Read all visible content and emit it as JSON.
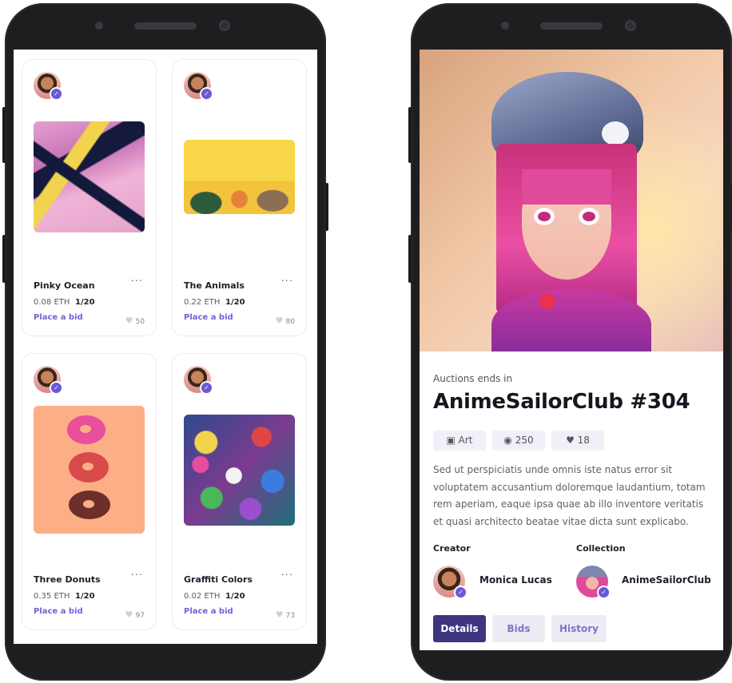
{
  "cards": [
    {
      "title": "Pinky Ocean",
      "price": "0.08 ETH",
      "edition": "1/20",
      "bid": "Place a bid",
      "likes": "50",
      "more": "···"
    },
    {
      "title": "The Animals",
      "price": "0.22 ETH",
      "edition": "1/20",
      "bid": "Place a bid",
      "likes": "80",
      "more": "···"
    },
    {
      "title": "Three Donuts",
      "price": "0.35 ETH",
      "edition": "1/20",
      "bid": "Place a bid",
      "likes": "97",
      "more": "···"
    },
    {
      "title": "Graffiti Colors",
      "price": "0.02 ETH",
      "edition": "1/20",
      "bid": "Place a bid",
      "likes": "73",
      "more": "···"
    }
  ],
  "detail": {
    "auction_label": "Auctions ends in",
    "title": "AnimeSailorClub #304",
    "stats": {
      "category": "Art",
      "views": "250",
      "likes": "18"
    },
    "description": "Sed ut perspiciatis unde omnis iste natus error sit voluptatem accusantium doloremque laudantium, totam rem aperiam, eaque ipsa quae ab illo inventore veritatis et quasi architecto beatae vitae dicta sunt explicabo.",
    "creator_label": "Creator",
    "creator_name": "Monica Lucas",
    "collection_label": "Collection",
    "collection_name": "AnimeSailorClub",
    "tabs": [
      "Details",
      "Bids",
      "History"
    ]
  },
  "colors": {
    "accent": "#6b58d6",
    "tab_active": "#3d3580",
    "tab_bg": "#ececf4",
    "link": "#7360d8"
  }
}
